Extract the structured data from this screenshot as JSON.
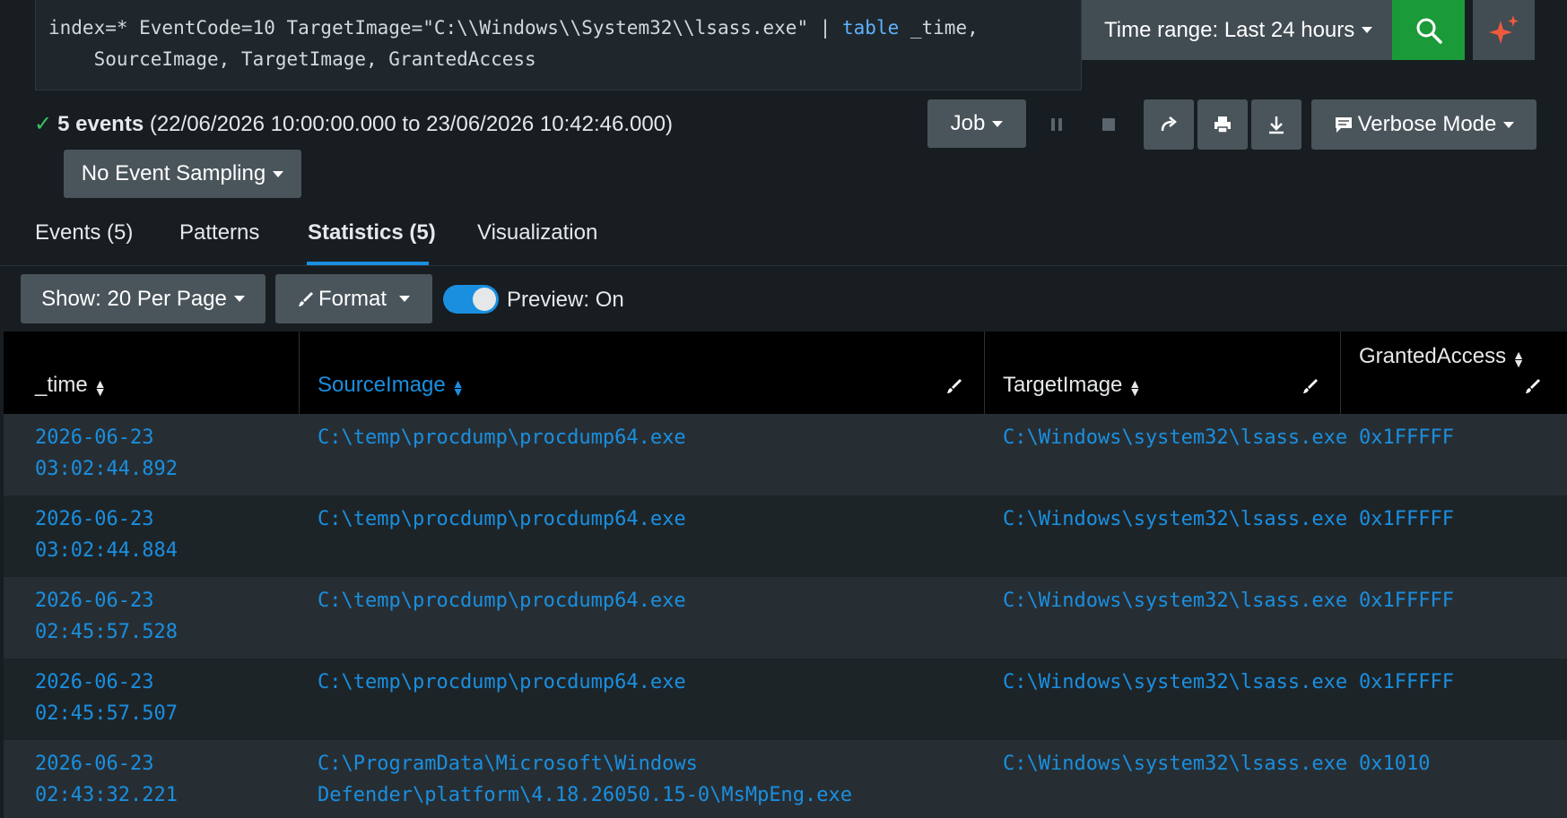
{
  "search": {
    "query_line1_a": "index=* EventCode=10 TargetImage=\"C:\\\\Windows\\\\System32\\\\lsass.exe\" | ",
    "query_line1_kw": "table",
    "query_line1_b": " _time,",
    "query_line2": "    SourceImage, TargetImage, GrantedAccess",
    "time_range_label": "Time range: Last 24 hours"
  },
  "status": {
    "count_label": "5 events",
    "range_label": "(22/06/2026 10:00:00.000 to 23/06/2026 10:42:46.000)"
  },
  "toolbar": {
    "job_label": "Job",
    "verbose_label": "Verbose Mode",
    "sampling_label": "No Event Sampling"
  },
  "tabs": [
    {
      "label": "Events (5)"
    },
    {
      "label": "Patterns"
    },
    {
      "label": "Statistics (5)"
    },
    {
      "label": "Visualization"
    }
  ],
  "controls": {
    "show_label": "Show: 20 Per Page",
    "format_label": "Format",
    "preview_label": "Preview: On"
  },
  "table": {
    "columns": [
      "_time",
      "SourceImage",
      "TargetImage",
      "GrantedAccess"
    ],
    "rows": [
      {
        "time_date": "2026-06-23",
        "time_clock": "03:02:44.892",
        "source_1": "C:\\temp\\procdump\\procdump64.exe",
        "source_2": "",
        "target": "C:\\Windows\\system32\\lsass.exe",
        "access": "0x1FFFFF"
      },
      {
        "time_date": "2026-06-23",
        "time_clock": "03:02:44.884",
        "source_1": "C:\\temp\\procdump\\procdump64.exe",
        "source_2": "",
        "target": "C:\\Windows\\system32\\lsass.exe",
        "access": "0x1FFFFF"
      },
      {
        "time_date": "2026-06-23",
        "time_clock": "02:45:57.528",
        "source_1": "C:\\temp\\procdump\\procdump64.exe",
        "source_2": "",
        "target": "C:\\Windows\\system32\\lsass.exe",
        "access": "0x1FFFFF"
      },
      {
        "time_date": "2026-06-23",
        "time_clock": "02:45:57.507",
        "source_1": "C:\\temp\\procdump\\procdump64.exe",
        "source_2": "",
        "target": "C:\\Windows\\system32\\lsass.exe",
        "access": "0x1FFFFF"
      },
      {
        "time_date": "2026-06-23",
        "time_clock": "02:43:32.221",
        "source_1": "C:\\ProgramData\\Microsoft\\Windows",
        "source_2": "Defender\\platform\\4.18.26050.15-0\\MsMpEng.exe",
        "target": "C:\\Windows\\system32\\lsass.exe",
        "access": "0x1010"
      }
    ]
  },
  "colors": {
    "accent": "#1a8fe0",
    "search_green": "#1b9a3a",
    "success_check": "#39c45d"
  }
}
